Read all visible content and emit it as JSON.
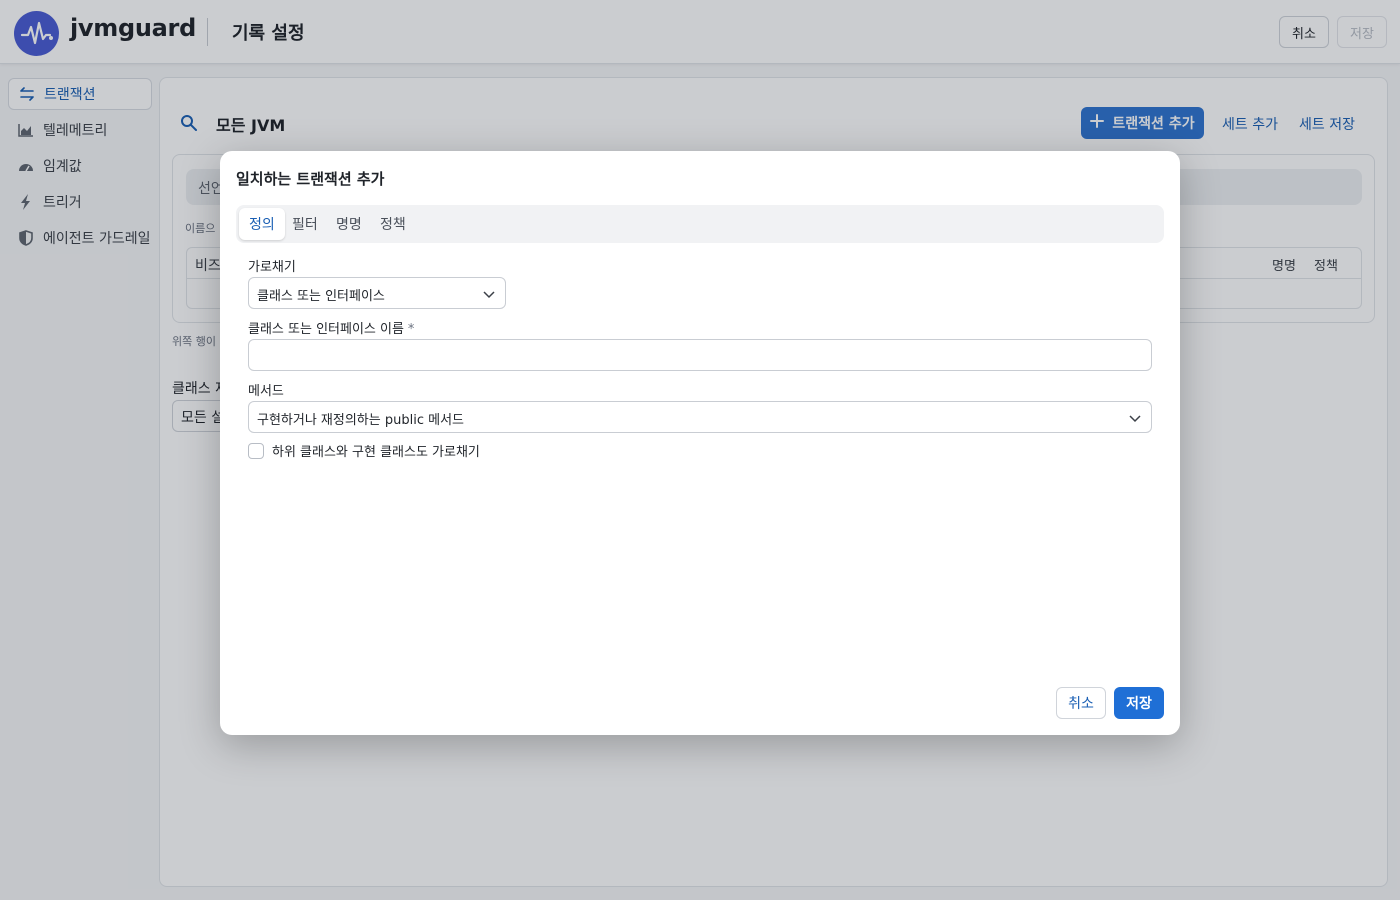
{
  "header": {
    "brand": "jvmguard",
    "page_title": "기록 설정",
    "cancel_label": "취소",
    "save_label": "저장"
  },
  "sidebar": {
    "items": [
      {
        "label": "트랜잭션",
        "icon": "transactions-icon",
        "active": true
      },
      {
        "label": "텔레메트리",
        "icon": "chart-icon",
        "active": false
      },
      {
        "label": "임계값",
        "icon": "gauge-icon",
        "active": false
      },
      {
        "label": "트리거",
        "icon": "lightning-icon",
        "active": false
      },
      {
        "label": "에이전트 가드레일",
        "icon": "shield-icon",
        "active": false
      }
    ]
  },
  "main": {
    "scope_label": "모든 JVM",
    "add_transaction_label": "트랜잭션 추가",
    "add_set_label": "세트 추가",
    "save_set_label": "세트 저장",
    "card_tab_partial": "선언",
    "card_hint_partial": "이름으",
    "col_business_partial": "비즈",
    "col_naming": "명명",
    "col_policy": "정책",
    "below_hint_partial": "위쪽 행이 다",
    "class_label_partial": "클래스 재",
    "class_select_partial": "모든 설"
  },
  "modal": {
    "title": "일치하는 트랜잭션 추가",
    "tabs": [
      {
        "label": "정의",
        "active": true
      },
      {
        "label": "필터",
        "active": false
      },
      {
        "label": "명명",
        "active": false
      },
      {
        "label": "정책",
        "active": false
      }
    ],
    "interceptor_label": "가로채기",
    "interceptor_value": "클래스 또는 인터페이스",
    "class_name_label": "클래스 또는 인터페이스 이름",
    "required_mark": "*",
    "class_name_value": "",
    "method_label": "메서드",
    "method_value": "구현하거나 재정의하는 public 메서드",
    "subclass_checkbox_label": "하위 클래스와 구현 클래스도 가로채기",
    "subclass_checked": false,
    "cancel_label": "취소",
    "save_label": "저장"
  },
  "colors": {
    "accent": "#1f6fd6",
    "logo": "#4a5bd4",
    "link": "#1a5fb4"
  }
}
